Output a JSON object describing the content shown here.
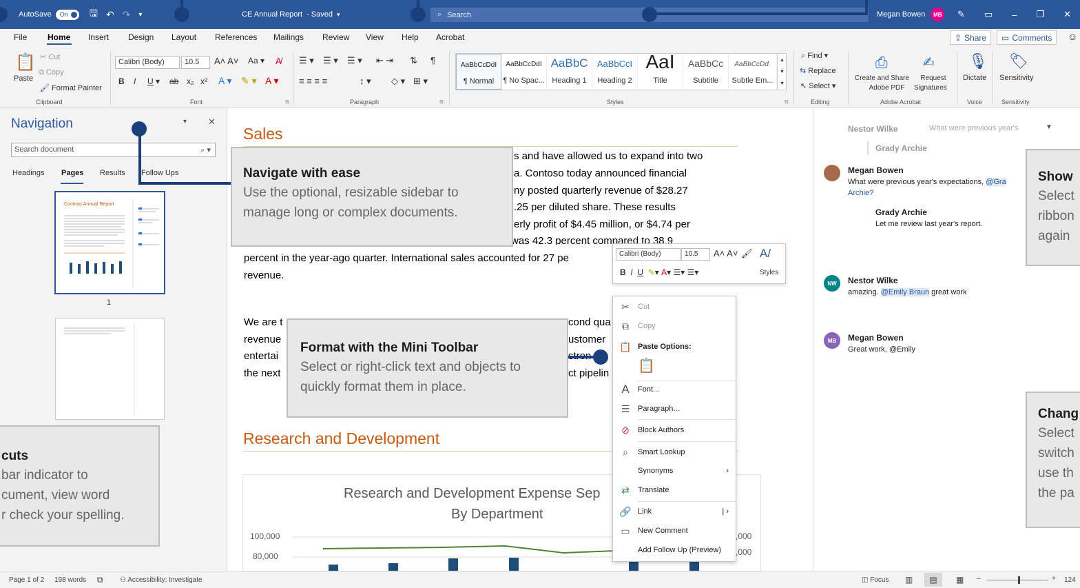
{
  "titlebar": {
    "autosave_label": "AutoSave",
    "autosave_state": "On",
    "doc_title": "CE Annual Report",
    "saved_status": "- Saved",
    "search_placeholder": "Search",
    "user_name": "Megan Bowen",
    "user_initials": "MB",
    "accent_color": "#2b579a"
  },
  "menu": {
    "items": [
      "File",
      "Home",
      "Insert",
      "Design",
      "Layout",
      "References",
      "Mailings",
      "Review",
      "View",
      "Help",
      "Acrobat"
    ],
    "share_label": "Share",
    "comments_label": "Comments"
  },
  "ribbon": {
    "clipboard": {
      "paste": "Paste",
      "cut": "Cut",
      "copy": "Copy",
      "format_painter": "Format Painter",
      "group": "Clipboard"
    },
    "font": {
      "name": "Calibri (Body)",
      "size": "10.5",
      "group": "Font"
    },
    "paragraph": {
      "group": "Paragraph"
    },
    "styles": {
      "group": "Styles",
      "items": [
        {
          "preview": "AaBbCcDdI",
          "name": "¶ Normal"
        },
        {
          "preview": "AaBbCcDdI",
          "name": "¶ No Spac..."
        },
        {
          "preview": "AaBbC",
          "name": "Heading 1"
        },
        {
          "preview": "AaBbCcI",
          "name": "Heading 2"
        },
        {
          "preview": "AaI",
          "name": "Title"
        },
        {
          "preview": "AaBbCc",
          "name": "Subtitle"
        },
        {
          "preview": "AaBbCcDd.",
          "name": "Subtle Em..."
        }
      ]
    },
    "editing": {
      "find": "Find",
      "replace": "Replace",
      "select": "Select",
      "group": "Editing"
    },
    "acrobat": {
      "create": "Create and Share",
      "create2": "Adobe PDF",
      "request": "Request",
      "request2": "Signatures",
      "group": "Adobe Acrobat"
    },
    "voice": {
      "dictate": "Dictate",
      "group": "Voice"
    },
    "sensitivity": {
      "label": "Sensitivity",
      "group": "Sensitivity"
    }
  },
  "nav": {
    "title": "Navigation",
    "search_placeholder": "Search document",
    "tabs": [
      "Headings",
      "Pages",
      "Results",
      "Follow Ups"
    ],
    "page_number": "1",
    "thumb_title": "Contoso Annual Report"
  },
  "doc": {
    "sales_heading": "Sales",
    "lines1": [
      "s and have allowed us to expand into two",
      "a.  Contoso today announced financial",
      "ny posted quarterly revenue of $28.27",
      ".25 per diluted share. These results",
      "erly profit of $4.45 million, or $4.74 per",
      "was 42.3 percent compared to 38.9"
    ],
    "line_full": "percent in the year-ago quarter. International sales accounted for 27 pe",
    "line_rev": "revenue.",
    "para2_left": [
      "We are t",
      "revenue",
      "entertai",
      "the next"
    ],
    "para2_right": [
      "cond qua",
      "ustomer",
      "stron",
      "ct pipelin"
    ],
    "rd_heading": "Research and Development",
    "chart_title1": "Research and Development Expense Sep",
    "chart_title2": "By Department",
    "y_ticks": [
      "100,000",
      "80,000"
    ],
    "right_ticks": [
      ",000",
      ",000"
    ]
  },
  "mini_toolbar": {
    "font": "Calibri (Body)",
    "size": "10.5",
    "styles": "Styles"
  },
  "context_menu": {
    "items": [
      "Cut",
      "Copy",
      "Paste Options:",
      "Font...",
      "Paragraph...",
      "Block Authors",
      "Smart Lookup",
      "Synonyms",
      "Translate",
      "Link",
      "New Comment",
      "Add Follow Up (Preview)"
    ]
  },
  "comments": {
    "head_name": "Nestor Wilke",
    "head_text": "What were previous year's",
    "reply_name": "Grady Archie",
    "c1_name": "Megan Bowen",
    "c1_text_a": "What were previous year's expectations,",
    "c1_mention": "@Gra",
    "c1_text_b": "Archie?",
    "c1_reply_name": "Grady Archie",
    "c1_reply_text": "Let me review last year's report.",
    "c2_name": "Nestor Wilke",
    "c2_initials": "NW",
    "c2_text_a": "amazing.",
    "c2_mention": "@Emily Braun",
    "c2_text_b": "great work",
    "c3_name": "Megan Bowen",
    "c3_initials": "MB",
    "c3_text": "Great work, @Emily"
  },
  "callouts": {
    "nav": {
      "title": "Navigate with ease",
      "body1": "Use the optional, resizable sidebar to",
      "body2": "manage long or complex documents."
    },
    "mini": {
      "title": "Format with the Mini Toolbar",
      "body1": "Select or right-click text and objects to",
      "body2": "quickly format them in place."
    },
    "shortcuts": {
      "title": "cuts",
      "body1": "bar indicator to",
      "body2": "cument, view word",
      "body3": "r check your spelling."
    },
    "show": {
      "title": "Show",
      "body1": "Select",
      "body2": "ribbon",
      "body3": "again"
    },
    "change": {
      "title": "Chang",
      "body1": "Select",
      "body2": "switch",
      "body3": "use th",
      "body4": "the pa"
    }
  },
  "status": {
    "page": "Page 1 of 2",
    "words": "198 words",
    "accessibility": "Accessibility: Investigate",
    "focus": "Focus",
    "zoom": "124"
  }
}
